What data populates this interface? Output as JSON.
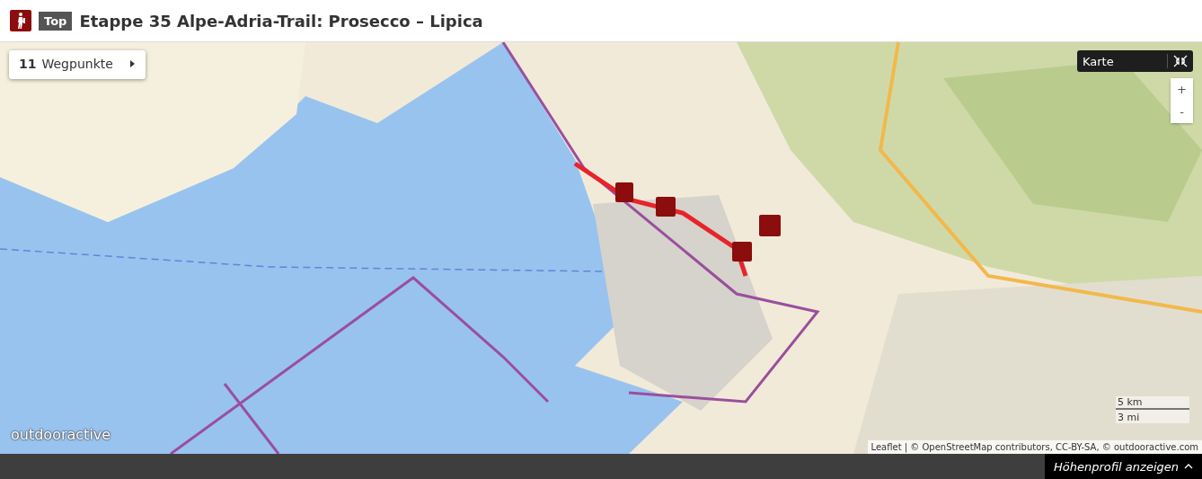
{
  "header": {
    "badge": "Top",
    "title": "Etappe 35 Alpe-Adria-Trail: Prosecco – Lipica"
  },
  "map": {
    "waypoints": {
      "count": "11",
      "label": "Wegpunkte"
    },
    "layer": "Karte",
    "zoom_in": "+",
    "zoom_out": "-",
    "logo": "outdooractive",
    "scale": [
      "5 km",
      "3 mi"
    ],
    "attribution": "Leaflet | © OpenStreetMap contributors, CC-BY-SA, © outdooractive.com"
  },
  "footer": {
    "button": "Höhenprofil anzeigen"
  }
}
